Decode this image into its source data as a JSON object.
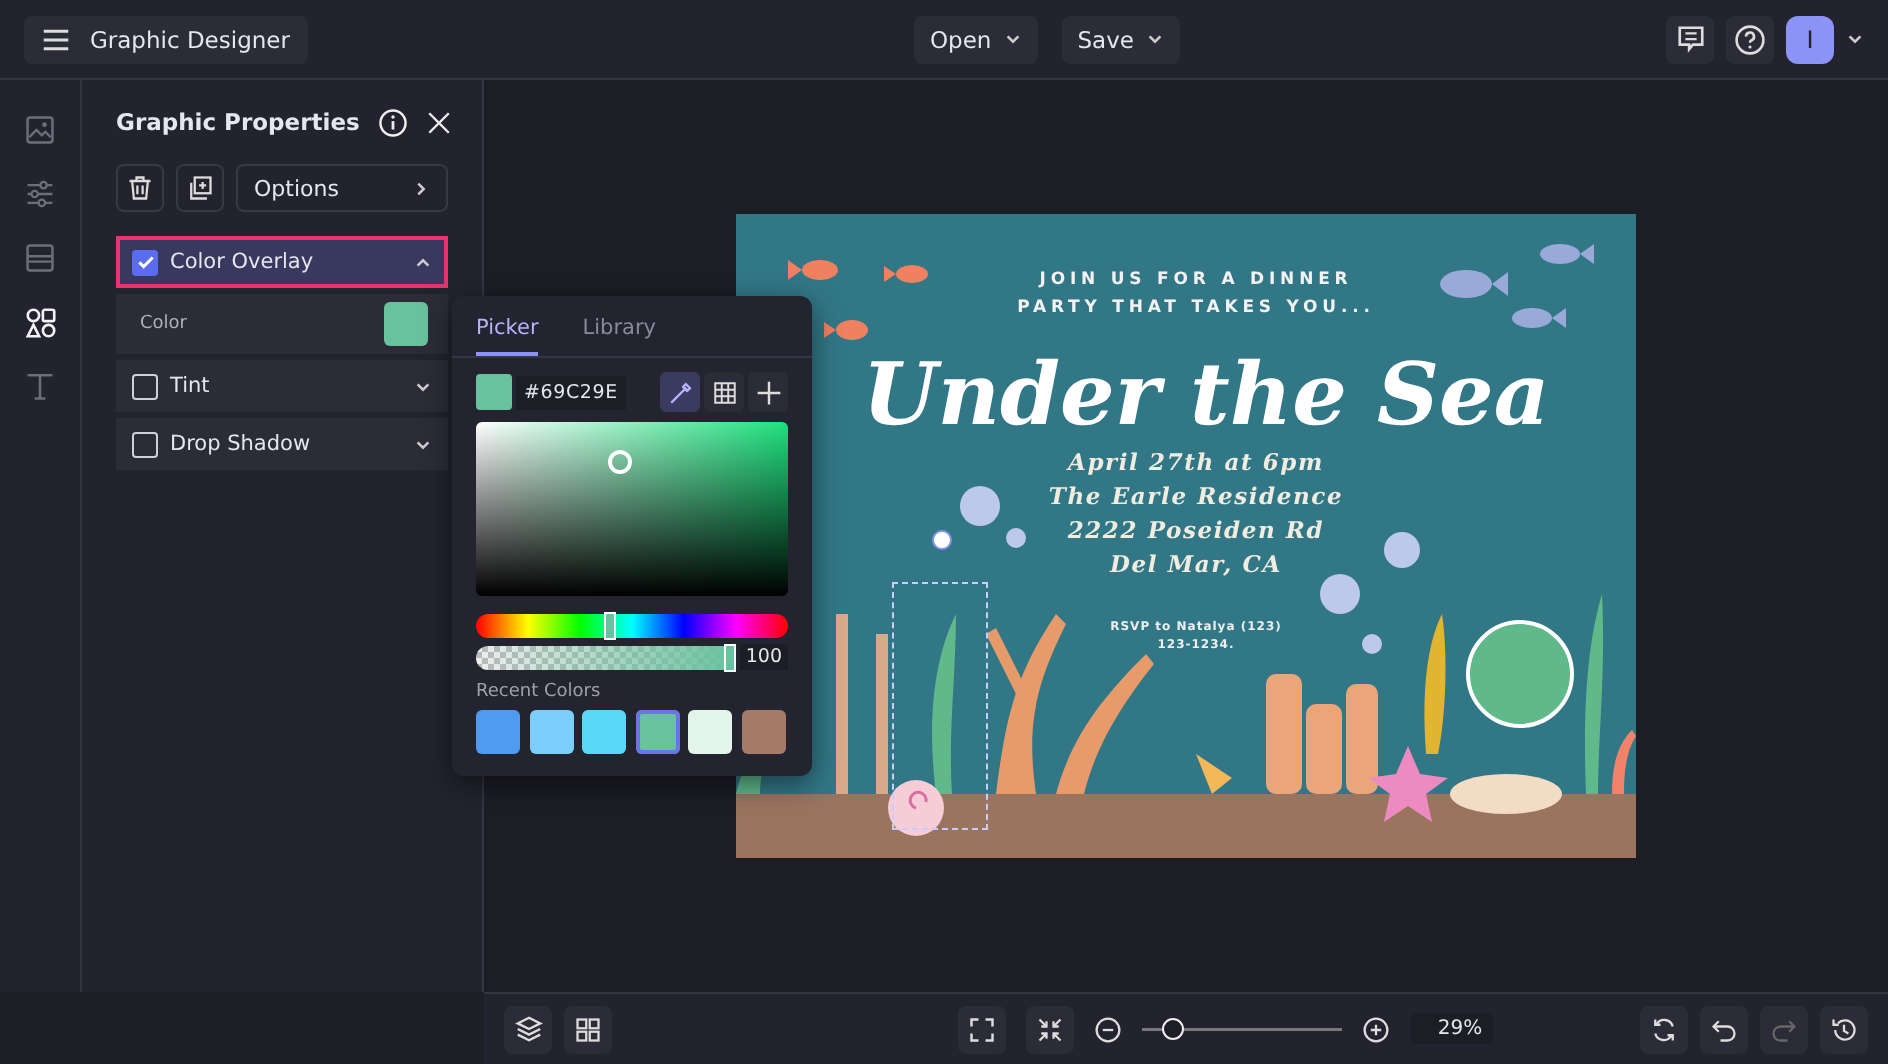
{
  "header": {
    "app_title": "Graphic Designer",
    "menus": [
      {
        "label": "Open"
      },
      {
        "label": "Save"
      }
    ],
    "avatar_initial": "I"
  },
  "rail": [
    {
      "kind": "image",
      "selected": false
    },
    {
      "kind": "sliders",
      "selected": false
    },
    {
      "kind": "layout",
      "selected": false
    },
    {
      "kind": "shapes",
      "selected": true
    },
    {
      "kind": "text",
      "selected": false
    }
  ],
  "panel": {
    "title": "Graphic Properties",
    "options_label": "Options",
    "color_label": "Color",
    "color": "#69c29e",
    "effects": [
      {
        "label": "Color Overlay",
        "checked": true,
        "expanded": true,
        "highlighted": true
      },
      {
        "label": "Tint",
        "checked": false,
        "expanded": false,
        "highlighted": false
      },
      {
        "label": "Drop Shadow",
        "checked": false,
        "expanded": false,
        "highlighted": false
      }
    ]
  },
  "picker": {
    "tabs": [
      {
        "label": "Picker",
        "selected": true
      },
      {
        "label": "Library",
        "selected": false
      }
    ],
    "hex": "#69C29E",
    "hue": {
      "level": 0.43
    },
    "alpha": {
      "level": 1
    },
    "opacity": "100",
    "recent_label": "Recent Colors",
    "recent": [
      {
        "color": "#4f9bf2",
        "selected": false
      },
      {
        "color": "#7ccffa",
        "selected": false
      },
      {
        "color": "#5ad8f7",
        "selected": false
      },
      {
        "color": "#69c29e",
        "selected": true
      },
      {
        "color": "#e3f4ea",
        "selected": false
      },
      {
        "color": "#a57a66",
        "selected": false
      }
    ]
  },
  "artwork": {
    "intro": [
      "JOIN US FOR A DINNER",
      "PARTY THAT TAKES YOU..."
    ],
    "title": "Under the Sea",
    "details": [
      "April 27th at 6pm",
      "The Earle Residence",
      "2222 Poseiden Rd",
      "Del Mar, CA"
    ],
    "rsvp": [
      "RSVP to Natalya (123)",
      "123-1234."
    ]
  },
  "zoom": {
    "level": 0.1,
    "reading": "29%"
  }
}
